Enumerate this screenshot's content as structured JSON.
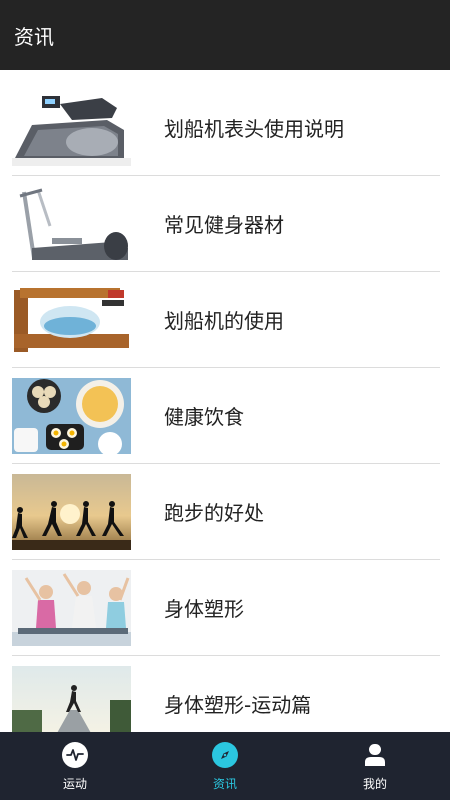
{
  "header": {
    "title": "资讯"
  },
  "articles": [
    {
      "title": "划船机表头使用说明",
      "thumb_icon": "rowing-machine-monitor-image"
    },
    {
      "title": "常见健身器材",
      "thumb_icon": "elliptical-trainer-image"
    },
    {
      "title": "划船机的使用",
      "thumb_icon": "water-rower-image"
    },
    {
      "title": "健康饮食",
      "thumb_icon": "healthy-food-image"
    },
    {
      "title": "跑步的好处",
      "thumb_icon": "runners-sunset-image"
    },
    {
      "title": "身体塑形",
      "thumb_icon": "women-stretching-image"
    },
    {
      "title": "身体塑形-运动篇",
      "thumb_icon": "road-runner-image"
    }
  ],
  "tabbar": {
    "tabs": [
      {
        "label": "运动",
        "icon": "pulse-icon",
        "active": false
      },
      {
        "label": "资讯",
        "icon": "compass-icon",
        "active": true
      },
      {
        "label": "我的",
        "icon": "user-icon",
        "active": false
      }
    ]
  },
  "colors": {
    "header_bg": "#242424",
    "tabbar_bg": "#1f2430",
    "accent": "#2bc7e0"
  }
}
